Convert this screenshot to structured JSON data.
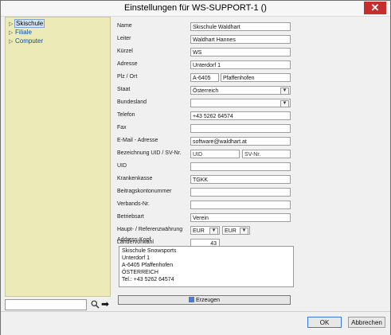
{
  "window": {
    "title": "Einstellungen für WS-SUPPORT-1 ()",
    "close_label": "✕"
  },
  "tree": {
    "items": [
      {
        "label": "Skischule"
      },
      {
        "label": "Filiale"
      },
      {
        "label": "Computer"
      }
    ]
  },
  "search": {
    "value": "",
    "placeholder": ""
  },
  "form": {
    "name_label": "Name",
    "name_value": "Skischule Waldhart",
    "leiter_label": "Leiter",
    "leiter_value": "Waldhart Hannes",
    "kuerzel_label": "Kürzel",
    "kuerzel_value": "WS",
    "adresse_label": "Adresse",
    "adresse_value": "Unterdorf 1",
    "plz_ort_label": "Plz / Ort",
    "plz_value": "A-6405",
    "ort_value": "Pfaffenhofen",
    "staat_label": "Staat",
    "staat_value": "Österreich",
    "bundesland_label": "Bundesland",
    "bundesland_value": "",
    "telefon_label": "Telefon",
    "telefon_value": "+43 5262 64574",
    "fax_label": "Fax",
    "fax_value": "",
    "email_label": "E-Mail - Adresse",
    "email_value": "software@waldhart.at",
    "uid_sv_label": "Bezeichnung UID / SV-Nr.",
    "uid_placeholder": "UID",
    "sv_placeholder": "SV-Nr.",
    "uid_label": "UID",
    "uid_value": "",
    "krankenkasse_label": "Krankenkasse",
    "krankenkasse_value": "TGKK",
    "beitragskontonummer_label": "Beitragskontonummer",
    "beitragskontonummer_value": "",
    "verbands_label": "Verbands-Nr.",
    "verbands_value": "",
    "betriebsart_label": "Betriebsart",
    "betriebsart_value": "Verein",
    "waehrung_label": "Haupt- / Referenzwährung",
    "haupt_waehrung": "EUR",
    "ref_waehrung": "EUR",
    "laendervorwahl_label": "Ländervorwahl",
    "laendervorwahl_value": "43",
    "adress_kopf_label": "Address-Kopf",
    "adress_kopf_lines": [
      "Skischule Snowsports",
      "Unterdorf 1",
      "A-6405 Pfaffenhofen",
      "ÖSTERREICH",
      "Tel.: +43 5262 64574"
    ],
    "erzeugen_label": "Erzeugen"
  },
  "footer": {
    "ok_label": "OK",
    "cancel_label": "Abbrechen"
  },
  "colors": {
    "tree_background": "#ecebb7",
    "tree_text": "#134d9a",
    "close_button": "#c62e2e"
  }
}
